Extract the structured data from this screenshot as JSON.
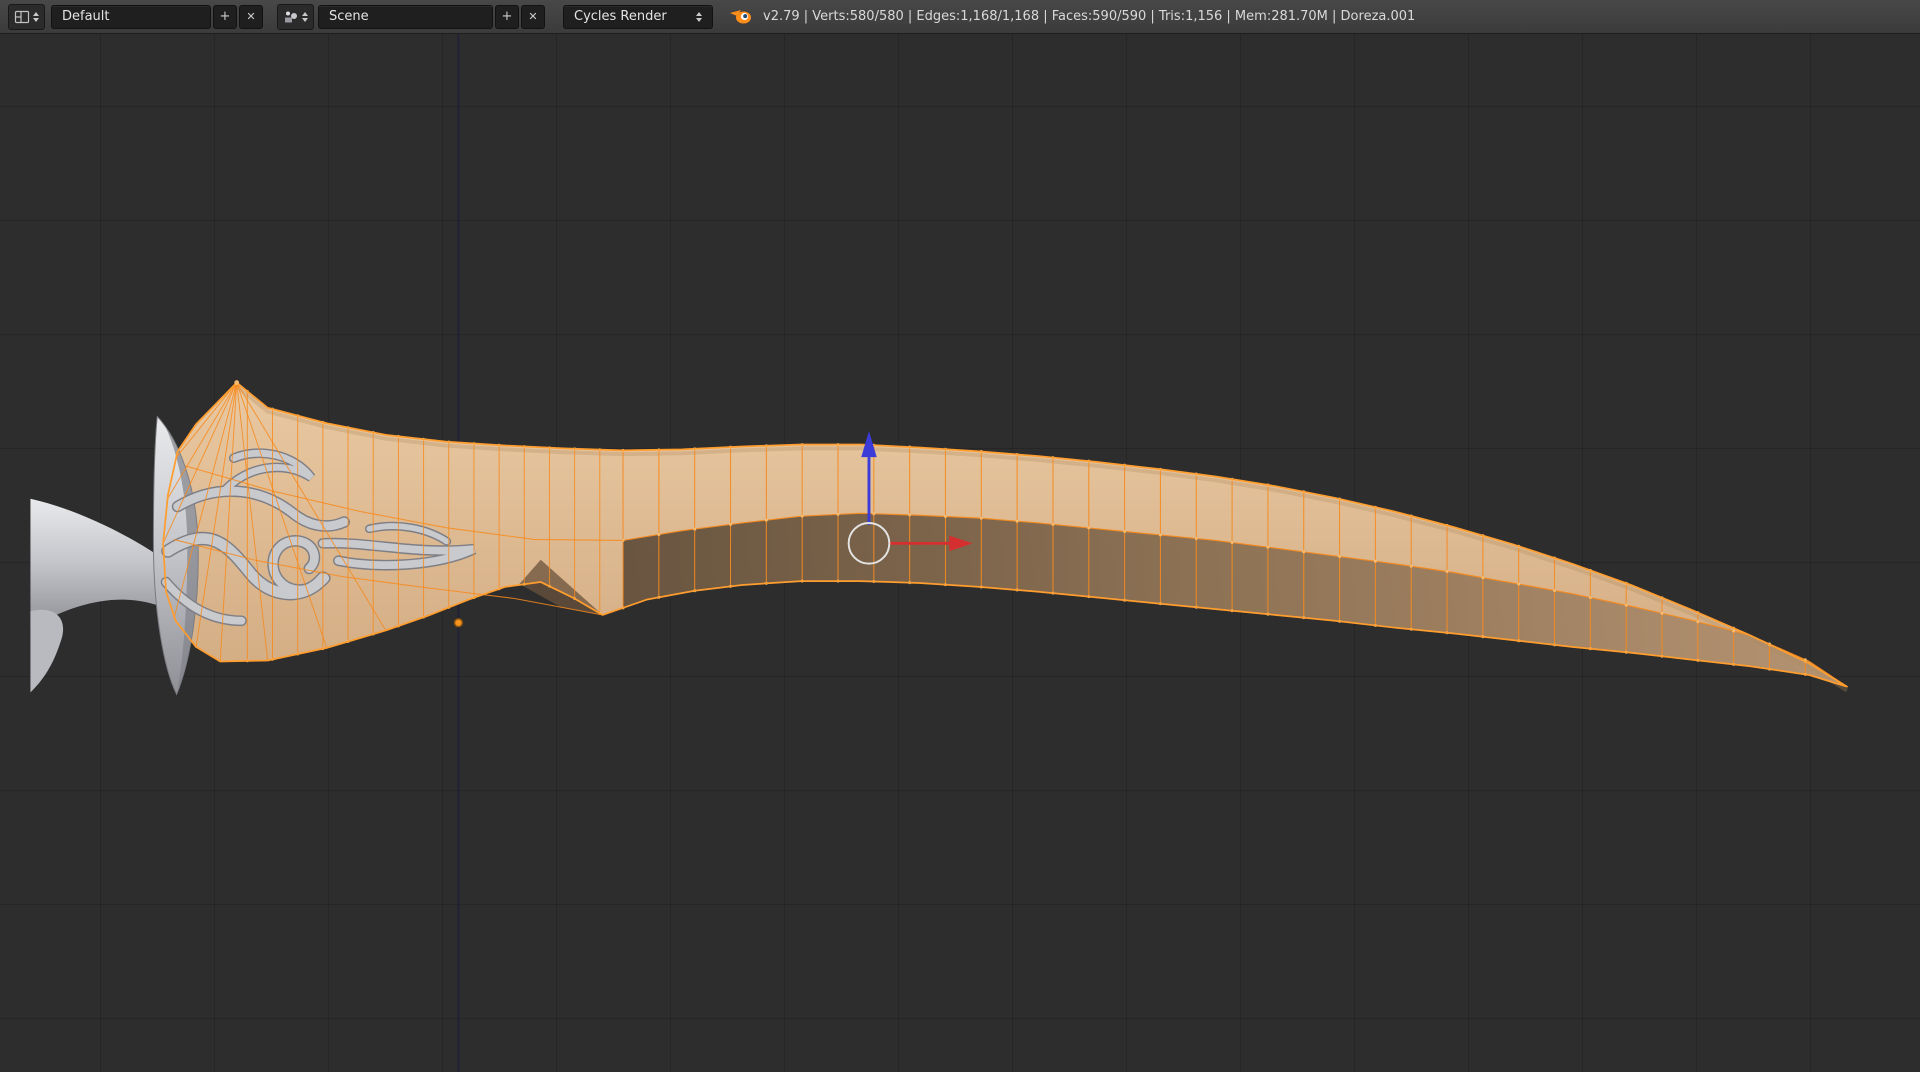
{
  "header": {
    "layout_value": "Default",
    "scene_value": "Scene",
    "engine_value": "Cycles Render",
    "stats": "v2.79 | Verts:580/580 | Edges:1,168/1,168 | Faces:590/590 | Tris:1,156 | Mem:281.70M | Doreza.001"
  },
  "icons": {
    "plus": "+",
    "close": "✕"
  },
  "colors": {
    "accent_orange": "#ff9d2e",
    "selected_wire": "#f78a1d",
    "vertex_dot": "#ffc277",
    "axis_x_red": "#d62f2f",
    "axis_z_blue": "#3b3bd8"
  }
}
